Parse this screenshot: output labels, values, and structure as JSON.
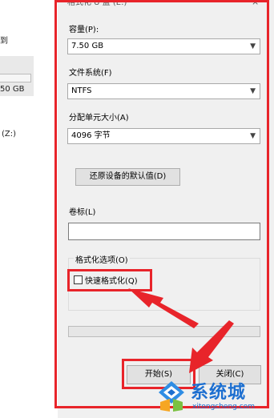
{
  "background_window": {
    "text_top": "到",
    "capacity_text": "50 GB",
    "drive_text": "(Z:)"
  },
  "dialog": {
    "title_partial": "格式化 U 盘 (E:)",
    "close_icon": "×",
    "capacity": {
      "label": "容量(P):",
      "value": "7.50 GB"
    },
    "filesystem": {
      "label": "文件系统(F)",
      "value": "NTFS"
    },
    "allocation": {
      "label": "分配单元大小(A)",
      "value": "4096 字节"
    },
    "restore_defaults_label": "还原设备的默认值(D)",
    "volume_label": {
      "label": "卷标(L)",
      "value": ""
    },
    "format_options": {
      "title": "格式化选项(O)",
      "quick_format_label": "快速格式化(Q)",
      "quick_format_checked": false
    },
    "progress": 0,
    "start_label": "开始(S)",
    "close_label": "关闭(C)"
  },
  "watermark": {
    "name": "系统城",
    "url": "xitongcheng.com"
  },
  "colors": {
    "annotation_red": "#e8242a",
    "watermark_blue": "#1d6fd0"
  }
}
